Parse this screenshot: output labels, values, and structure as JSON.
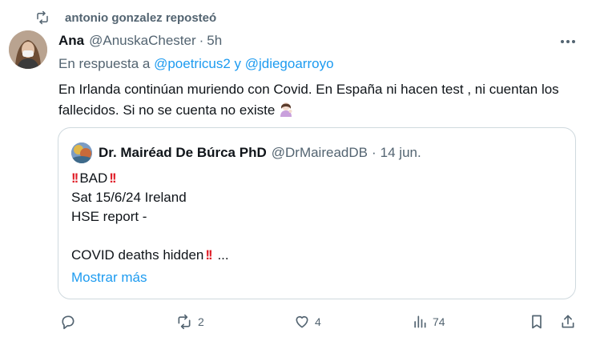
{
  "repost": {
    "label": "antonio gonzalez reposteó",
    "icon": "repost-icon"
  },
  "tweet": {
    "author_name": "Ana",
    "author_handle": "@AnuskaChester",
    "separator": "·",
    "time": "5h",
    "reply_prefix": "En respuesta a ",
    "reply_users": "@poetricus2 y @jdiegoarroyo",
    "text": "En Irlanda continúan muriendo con Covid. En España ni hacen test , ni cuentan los fallecidos. Si no se cuenta no existe",
    "more_icon": "more-horizontal-icon",
    "emoji": "woman-tipping-hand-emoji"
  },
  "quote": {
    "author_name": "Dr. Mairéad De Búrca PhD",
    "author_handle": "@DrMaireadDB",
    "separator": "·",
    "time": "14 jun.",
    "line1": "BAD",
    "line2": "Sat 15/6/24 Ireland",
    "line3": "HSE report -",
    "line5": "COVID deaths hidden",
    "ellipsis": " ...",
    "show_more": "Mostrar más",
    "bang_icon": "double-exclamation-icon"
  },
  "actions": {
    "reply_icon": "reply-icon",
    "repost_count": "2",
    "like_count": "4",
    "views_count": "74",
    "bookmark_icon": "bookmark-icon",
    "share_icon": "share-icon"
  },
  "colors": {
    "accent": "#1d9bf0",
    "secondary_text": "#536471",
    "primary_text": "#0f1419",
    "border": "#cfd9de"
  }
}
